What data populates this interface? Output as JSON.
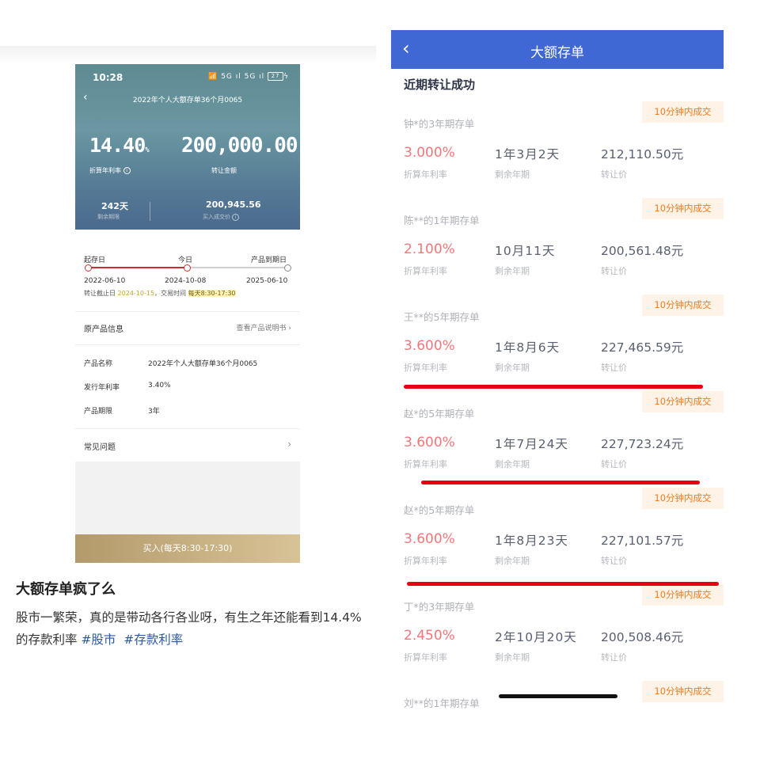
{
  "left_phone": {
    "status_time": "10:28",
    "status_icons": "📶 5G ıl 5G ıl",
    "battery": "27",
    "title": "2022年个人大额存单36个月0065",
    "rate_value": "14.40",
    "rate_unit": "%",
    "rate_label": "折算年利率",
    "amount_value": "200,000.00",
    "amount_label": "转让金额",
    "days_value": "242天",
    "days_label": "剩余期限",
    "price_value": "200,945.56",
    "price_label": "买入成交价",
    "timeline": {
      "start_label": "起存日",
      "today_label": "今日",
      "end_label": "产品到期日",
      "start_date": "2022-06-10",
      "today_date": "2024-10-08",
      "end_date": "2025-06-10",
      "note_prefix": "转让截止日 ",
      "note_date": "2024-10-15",
      "note_mid": "，交易时间 ",
      "note_time": "每天8:30-17:30"
    },
    "section_title": "原产品信息",
    "section_link": "查看产品说明书 ›",
    "details": [
      {
        "key": "产品名称",
        "value": "2022年个人大额存单36个月0065"
      },
      {
        "key": "发行年利率",
        "value": "3.40%"
      },
      {
        "key": "产品期限",
        "value": "3年"
      }
    ],
    "faq_label": "常见问题",
    "buy_button": "买入(每天8:30-17:30)"
  },
  "post": {
    "title": "大额存单疯了么",
    "body": "股市一繁荣，真的是带动各行各业呀，有生之年还能看到14.4%的存款利率 ",
    "tag1": "#股市",
    "tag2": "#存款利率"
  },
  "right_phone": {
    "header_title": "大额存单",
    "section_title": "近期转让成功",
    "rate_label": "折算年利率",
    "term_label": "剩余年期",
    "price_label": "转让价",
    "badge": "10分钟内成交",
    "items": [
      {
        "holder": "钟*的3年期存单",
        "rate": "3.000%",
        "term": "1年3月2天",
        "price": "212,110.50元"
      },
      {
        "holder": "陈**的1年期存单",
        "rate": "2.100%",
        "term": "10月11天",
        "price": "200,561.48元"
      },
      {
        "holder": "王**的5年期存单",
        "rate": "3.600%",
        "term": "1年8月6天",
        "price": "227,465.59元"
      },
      {
        "holder": "赵*的5年期存单",
        "rate": "3.600%",
        "term": "1年7月24天",
        "price": "227,723.24元"
      },
      {
        "holder": "赵*的5年期存单",
        "rate": "3.600%",
        "term": "1年8月23天",
        "price": "227,101.57元"
      },
      {
        "holder": "丁*的3年期存单",
        "rate": "2.450%",
        "term": "2年10月20天",
        "price": "200,508.46元"
      },
      {
        "holder": "刘**的1年期存单",
        "rate": "",
        "term": "",
        "price": ""
      }
    ]
  }
}
